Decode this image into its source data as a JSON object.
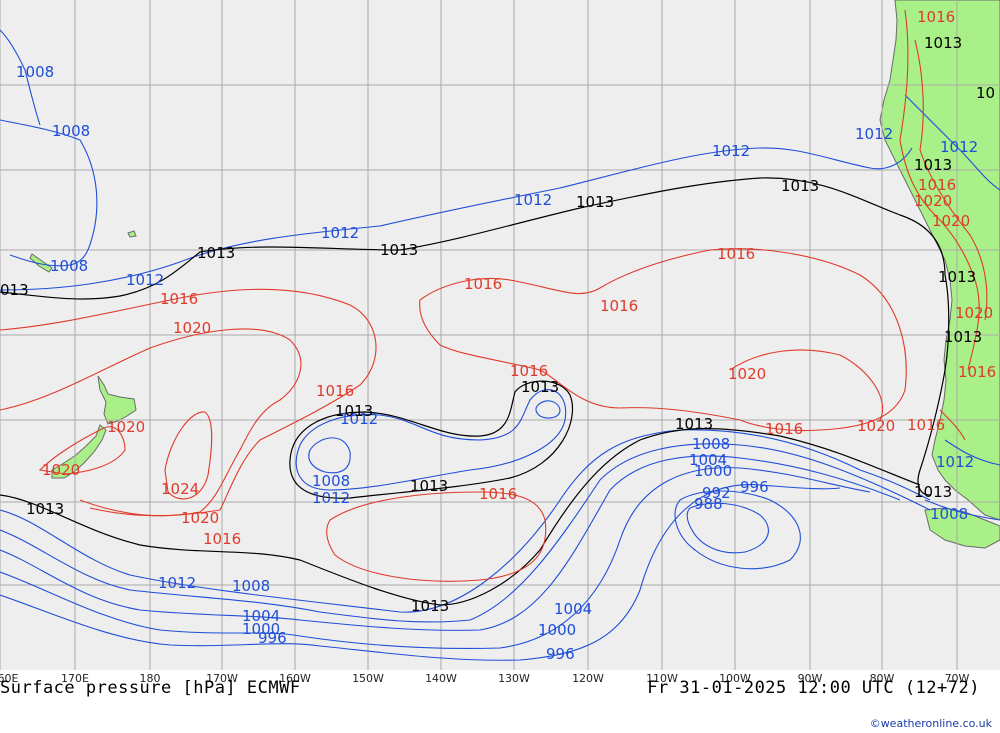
{
  "title": "Surface pressure [hPa] ECMWF",
  "valid_time": "Fr 31-01-2025 12:00 UTC (12+72)",
  "credit": "©weatheronline.co.uk",
  "longitude_labels": [
    "60E",
    "170E",
    "180",
    "170W",
    "160W",
    "150W",
    "140W",
    "130W",
    "120W",
    "110W",
    "100W",
    "90W",
    "80W",
    "70W"
  ],
  "colors": {
    "ocean": "#eeeeee",
    "land": "#aaf088",
    "grid": "#aaaaaa",
    "isobar_low": "#1f4ed8",
    "isobar_high": "#e03a2a",
    "isobar_1013": "#000000",
    "coast": "#6a6a6a"
  },
  "isobar_labels": {
    "b1008_nw": "1008",
    "b1008_w": "1008",
    "b1008_nz": "1008",
    "b1012_a": "1012",
    "b1012_b": "1012",
    "b1012_c": "1012",
    "b1012_d": "1012",
    "b1012_e": "1012",
    "b1012_f": "1012",
    "b1012_g": "1012",
    "b1012_h": "1012",
    "b1012_i": "1012",
    "b1012_j": "1012",
    "b1008_low": "1008",
    "b1008_s": "1008",
    "b1008_e": "1008",
    "b1008_chile": "1008",
    "b1004_s": "1004",
    "b1004_e": "1004",
    "b1004_c": "1004",
    "b1000_s": "1000",
    "b1000_e": "1000",
    "b1000_c": "1000",
    "b996_s": "996",
    "b996_e": "996",
    "b996_c": "996",
    "b992": "992",
    "b988": "988",
    "k1013_w": "013",
    "k1013_a": "1013",
    "k1013_b": "1013",
    "k1013_c": "1013",
    "k1013_d": "1013",
    "k1013_e": "1013",
    "k1013_f": "1013",
    "k1013_g": "1013",
    "k1013_h": "1013",
    "k1013_i": "1013",
    "k1013_j": "1013",
    "k1013_k": "1013",
    "k1013_l": "1013",
    "k1013_m": "1013",
    "k1013_n": "1013",
    "k1013_o": "10",
    "r1016_a": "1016",
    "r1016_b": "1016",
    "r1016_c": "1016",
    "r1016_d": "1016",
    "r1016_e": "1016",
    "r1016_f": "1016",
    "r1016_g": "1016",
    "r1016_h": "1016",
    "r1016_i": "1016",
    "r1016_j": "1016",
    "r1016_k": "1016",
    "r1016_l": "1016",
    "r1016_m": "1016",
    "r1020_a": "1020",
    "r1020_b": "1020",
    "r1020_c": "1020",
    "r1020_d": "1020",
    "r1020_e": "1020",
    "r1020_f": "1020",
    "r1020_g": "1020",
    "r1020_h": "1020",
    "r1020_i": "1020",
    "r1024": "1024"
  }
}
